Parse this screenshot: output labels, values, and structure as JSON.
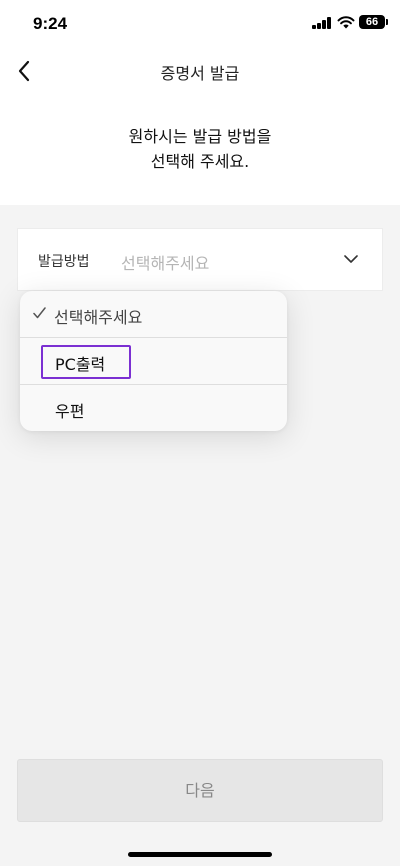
{
  "status_bar": {
    "time": "9:24",
    "battery": "66",
    "icons": [
      "cellular-signal-icon",
      "wifi-icon",
      "battery-icon"
    ]
  },
  "header": {
    "title": "증명서 발급",
    "back_icon": "chevron-left-icon"
  },
  "instruction": {
    "line1": "원하시는 발급 방법을",
    "line2": "선택해 주세요."
  },
  "form": {
    "label": "발급방법",
    "placeholder": "선택해주세요",
    "chevron_icon": "chevron-down-icon"
  },
  "dropdown": {
    "options": [
      {
        "label": "선택해주세요",
        "selected": true
      },
      {
        "label": "PC출력",
        "selected": false
      },
      {
        "label": "우편",
        "selected": false
      }
    ],
    "check_icon": "checkmark-icon",
    "highlight_color": "#7b2fd2"
  },
  "footer": {
    "next_label": "다음"
  }
}
